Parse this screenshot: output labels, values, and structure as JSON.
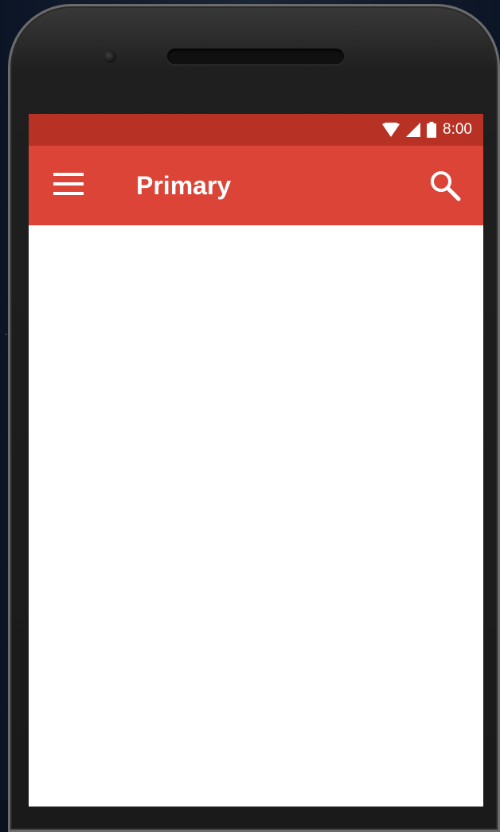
{
  "status_bar": {
    "time": "8:00",
    "icons": [
      "wifi-icon",
      "signal-icon",
      "battery-icon"
    ]
  },
  "app_bar": {
    "title": "Primary",
    "menu_icon": "hamburger-menu-icon",
    "search_icon": "search-icon"
  },
  "colors": {
    "status_bar": "#b73225",
    "app_bar": "#db4437",
    "content_background": "#ffffff"
  }
}
